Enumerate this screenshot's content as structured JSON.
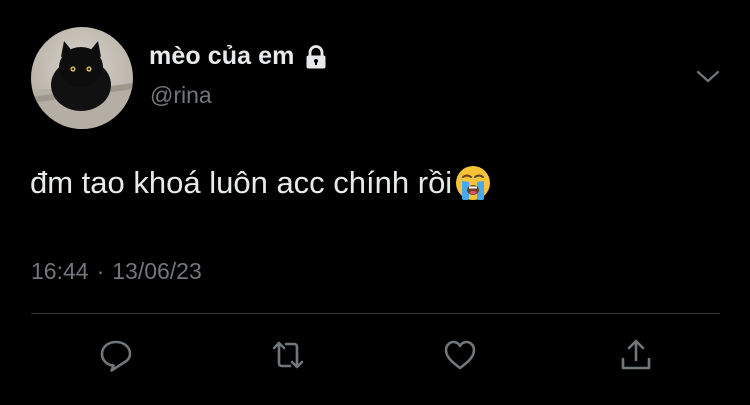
{
  "author": {
    "display_name": "mèo của em",
    "handle": "@rina",
    "avatar_icon": "black-cat-avatar",
    "protected_icon": "lock-icon"
  },
  "tweet": {
    "text": "đm tao khoá luôn acc chính rồi",
    "emoji": "loudly-crying-face-icon",
    "time": "16:44",
    "separator": "·",
    "date": "13/06/23"
  },
  "actions": [
    {
      "icon": "reply-icon"
    },
    {
      "icon": "retweet-icon"
    },
    {
      "icon": "like-icon"
    },
    {
      "icon": "share-icon"
    }
  ],
  "colors": {
    "background": "#000000",
    "primary_text": "#e7e9ea",
    "secondary_text": "#71767b",
    "divider": "#2f3336"
  }
}
